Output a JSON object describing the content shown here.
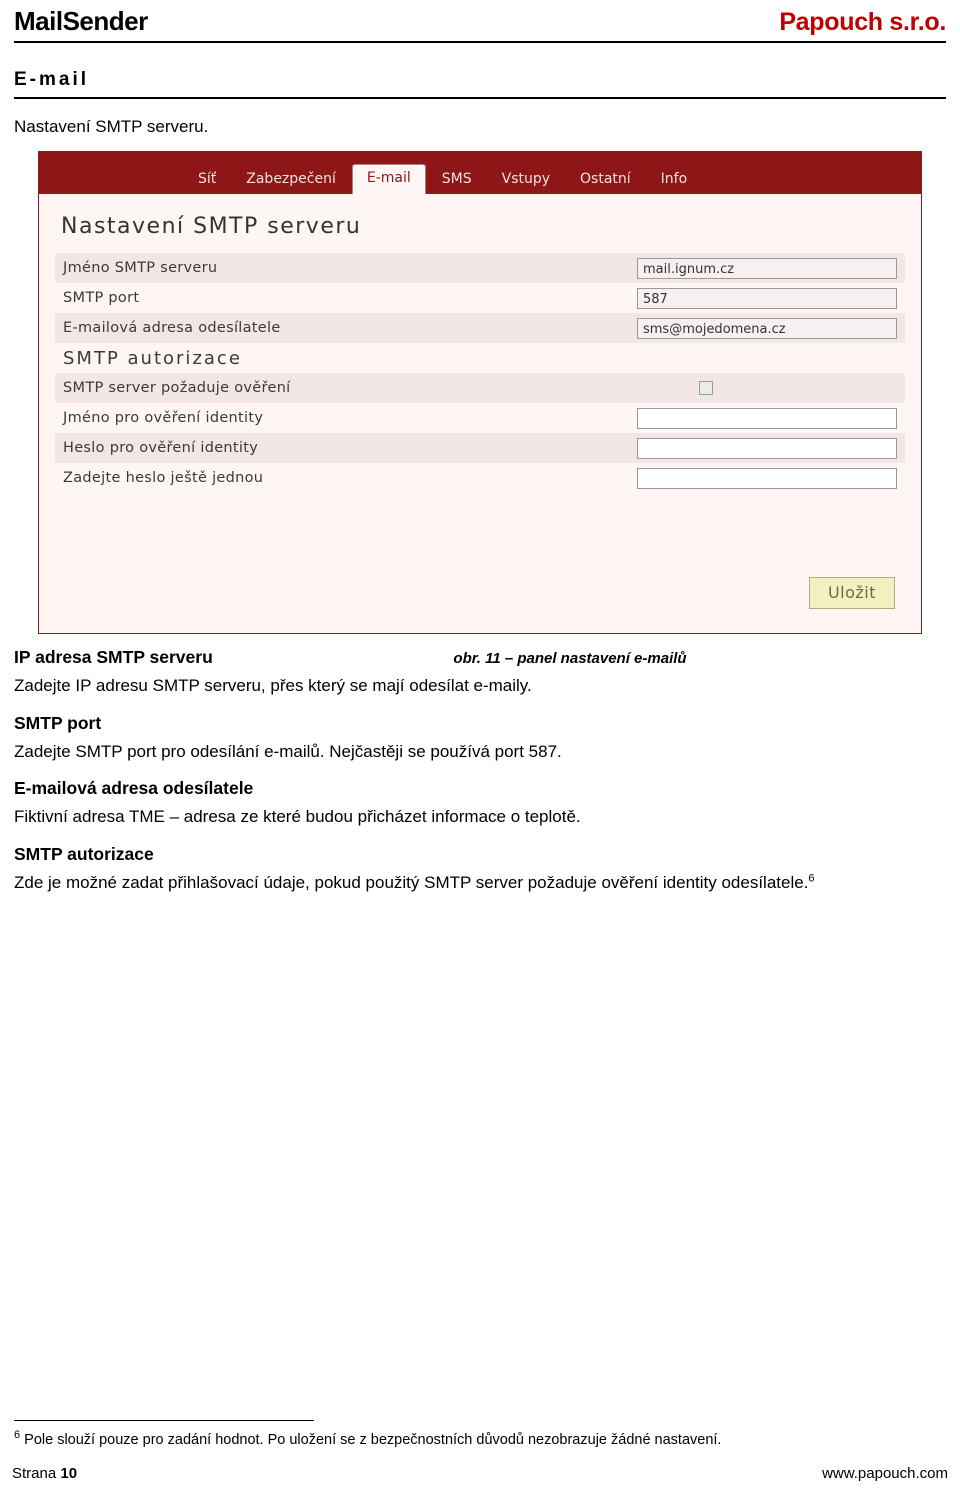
{
  "header": {
    "product": "MailSender",
    "company": "Papouch s.r.o."
  },
  "section": {
    "title": "E-mail",
    "lead": "Nastavení SMTP serveru."
  },
  "screenshot": {
    "tabs": [
      {
        "label": "Síť",
        "active": false
      },
      {
        "label": "Zabezpečení",
        "active": false
      },
      {
        "label": "E-mail",
        "active": true
      },
      {
        "label": "SMS",
        "active": false
      },
      {
        "label": "Vstupy",
        "active": false
      },
      {
        "label": "Ostatní",
        "active": false
      },
      {
        "label": "Info",
        "active": false
      }
    ],
    "heading": "Nastavení SMTP serveru",
    "rows": [
      {
        "label": "Jméno SMTP serveru",
        "value": "mail.ignum.cz"
      },
      {
        "label": "SMTP port",
        "value": "587"
      },
      {
        "label": "E-mailová adresa odesílatele",
        "value": "sms@mojedomena.cz"
      }
    ],
    "group_label": "SMTP autorizace",
    "checkbox_row": {
      "label": "SMTP server požaduje ověření",
      "checked": false
    },
    "auth_rows": [
      {
        "label": "Jméno pro ověření identity",
        "value": ""
      },
      {
        "label": "Heslo pro ověření identity",
        "value": ""
      },
      {
        "label": "Zadejte heslo ještě jednou",
        "value": ""
      }
    ],
    "save_label": "Uložit"
  },
  "figure_caption": "obr. 11 – panel nastavení e-mailů",
  "body": [
    {
      "heading": "IP adresa SMTP serveru",
      "text": "Zadejte IP adresu SMTP serveru, přes který se mají odesílat e-maily."
    },
    {
      "heading": "SMTP port",
      "text": "Zadejte SMTP port pro odesílání e-mailů. Nejčastěji se používá port 587."
    },
    {
      "heading": "E-mailová adresa odesílatele",
      "text": "Fiktivní adresa TME – adresa ze které budou přicházet informace o teplotě."
    },
    {
      "heading": "SMTP autorizace",
      "text": "Zde je možné zadat přihlašovací údaje, pokud použitý SMTP server požaduje ověření identity odesílatele.",
      "footnote_marker": "6"
    }
  ],
  "footnote": {
    "marker": "6",
    "text": "Pole slouží pouze pro zadání hodnot. Po uložení se z bezpečnostních důvodů nezobrazuje žádné nastavení."
  },
  "footer": {
    "page_prefix": "Strana",
    "page_number": "10",
    "url": "www.papouch.com"
  }
}
